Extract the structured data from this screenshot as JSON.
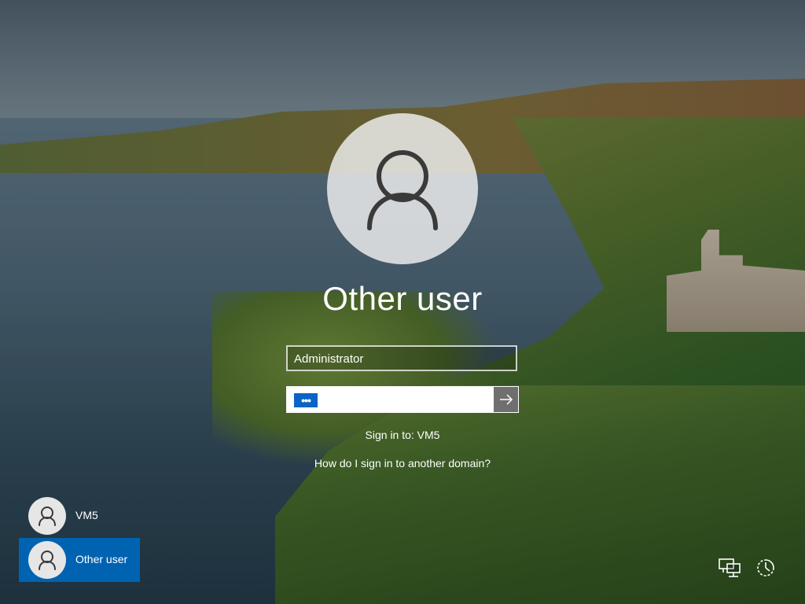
{
  "login": {
    "username": "Other user",
    "user_field_value": "Administrator",
    "password_mask": "•••",
    "signin_to": "Sign in to: VM5",
    "domain_help_link": "How do I sign in to another domain?"
  },
  "user_list": [
    {
      "label": "VM5",
      "selected": false
    },
    {
      "label": "Other user",
      "selected": true
    }
  ],
  "system_icons": {
    "network": "network-icon",
    "ease_of_access": "ease-of-access-icon",
    "submit": "arrow-right-icon",
    "avatar": "user-avatar-icon"
  },
  "colors": {
    "accent": "#0063b1",
    "password_mask_bg": "#0a64c8",
    "submit_bg": "#6f6f6f"
  }
}
